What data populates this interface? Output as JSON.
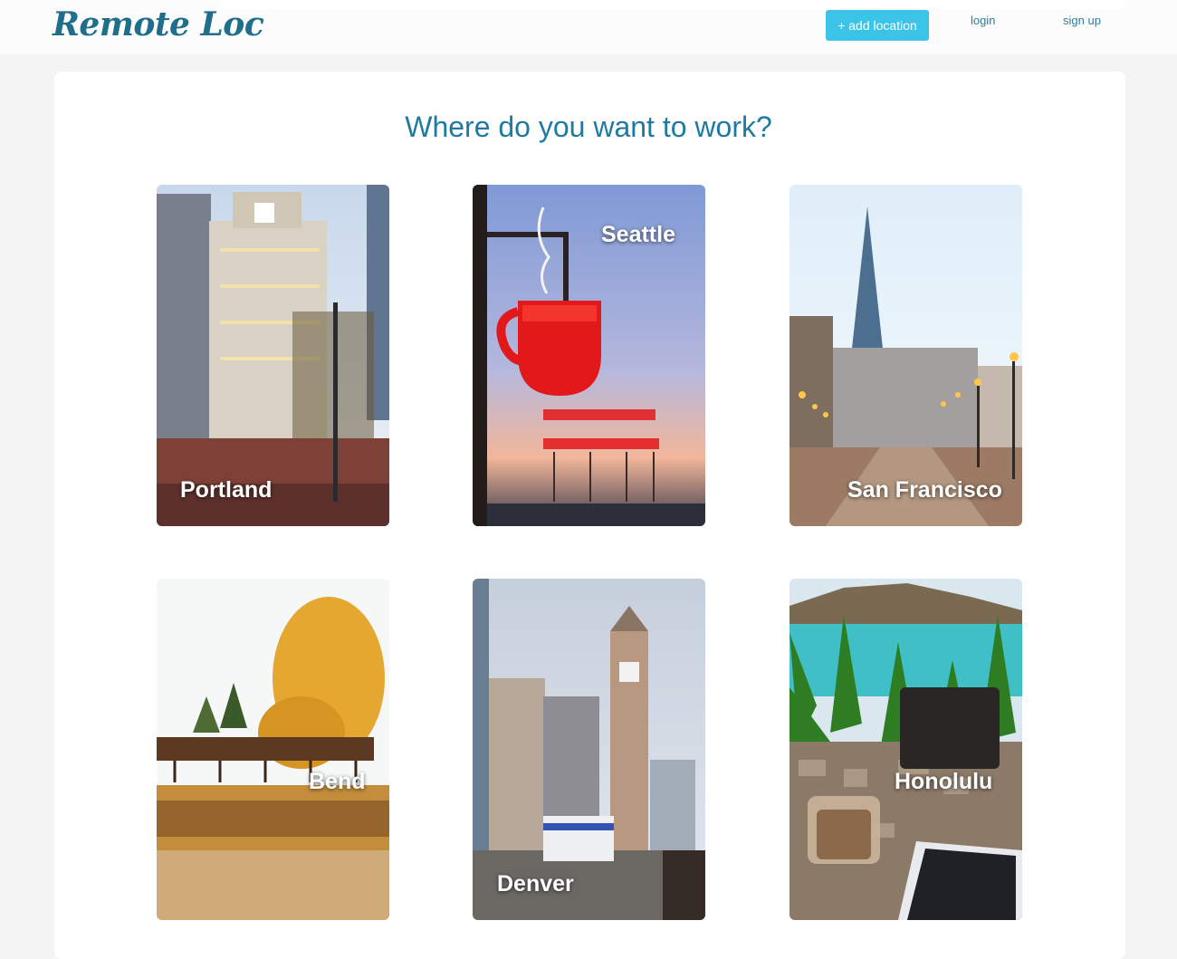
{
  "header": {
    "brand": "Remote Loc",
    "add_location_label": "+ add location",
    "login_label": "login",
    "signup_label": "sign up"
  },
  "main": {
    "title": "Where do you want to work?",
    "locations": [
      {
        "name": "Portland"
      },
      {
        "name": "Seattle"
      },
      {
        "name": "San Francisco"
      },
      {
        "name": "Bend"
      },
      {
        "name": "Denver"
      },
      {
        "name": "Honolulu"
      }
    ]
  },
  "colors": {
    "brand": "#1f6f8b",
    "accent_button": "#3cc3e8",
    "heading": "#1f7aa0",
    "link": "#2a7fa0",
    "page_background": "#f4f4f4"
  }
}
